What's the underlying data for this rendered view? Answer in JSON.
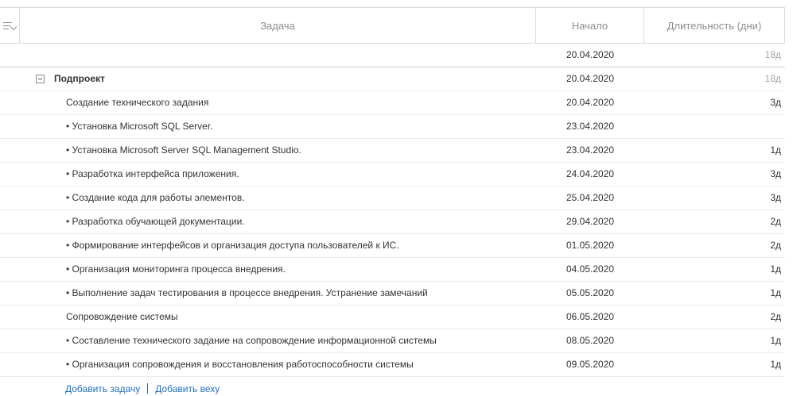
{
  "header": {
    "task": "Задача",
    "start": "Начало",
    "duration": "Длительность (дни)"
  },
  "rows": [
    {
      "task": "",
      "start": "20.04.2020",
      "duration": "18д"
    },
    {
      "task": "Подпроект",
      "start": "20.04.2020",
      "duration": "18д"
    },
    {
      "task": "Создание технического задания",
      "start": "20.04.2020",
      "duration": "3д"
    },
    {
      "task": "• Установка Microsoft SQL Server.",
      "start": "23.04.2020",
      "duration": ""
    },
    {
      "task": "• Установка Microsoft Server SQL Management Studio.",
      "start": "23.04.2020",
      "duration": "1д"
    },
    {
      "task": "• Разработка интерфейса приложения.",
      "start": "24.04.2020",
      "duration": "3д"
    },
    {
      "task": "• Создание кода для работы элементов.",
      "start": "25.04.2020",
      "duration": "3д"
    },
    {
      "task": "• Разработка обучающей документации.",
      "start": "29.04.2020",
      "duration": "2д"
    },
    {
      "task": "• Формирование интерфейсов и организация доступа пользователей к ИС.",
      "start": "01.05.2020",
      "duration": "2д"
    },
    {
      "task": "• Организация мониторинга процесса внедрения.",
      "start": "04.05.2020",
      "duration": "1д"
    },
    {
      "task": "• Выполнение задач тестирования в процессе внедрения. Устранение замечаний",
      "start": "05.05.2020",
      "duration": "1д"
    },
    {
      "task": "Сопровождение системы",
      "start": "06.05.2020",
      "duration": "2д"
    },
    {
      "task": "• Составление технического задание на сопровождение информационной системы",
      "start": "08.05.2020",
      "duration": "1д"
    },
    {
      "task": "• Организация сопровождения и восстановления работоспособности системы",
      "start": "09.05.2020",
      "duration": "1д"
    }
  ],
  "footer": {
    "add_task": "Добавить задачу",
    "add_milestone": "Добавить веху"
  }
}
